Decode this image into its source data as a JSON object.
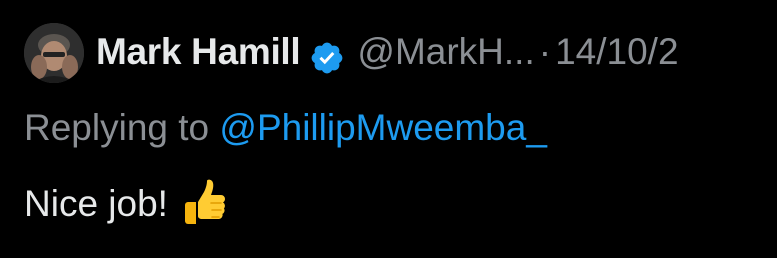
{
  "tweet": {
    "display_name": "Mark Hamill",
    "handle": "@MarkH...",
    "separator": "·",
    "date": "14/10/2",
    "reply_prefix": "Replying to ",
    "reply_mention": "@PhillipMweemba_",
    "body": "Nice job!",
    "emoji": "thumbs-up"
  },
  "icons": {
    "verified": "verified-badge-icon",
    "emoji": "thumbs-up-emoji"
  },
  "colors": {
    "background": "#000000",
    "name": "#e7e9ea",
    "secondary": "#8b8f94",
    "link": "#1d9bf0",
    "verified": "#1d9bf0"
  }
}
